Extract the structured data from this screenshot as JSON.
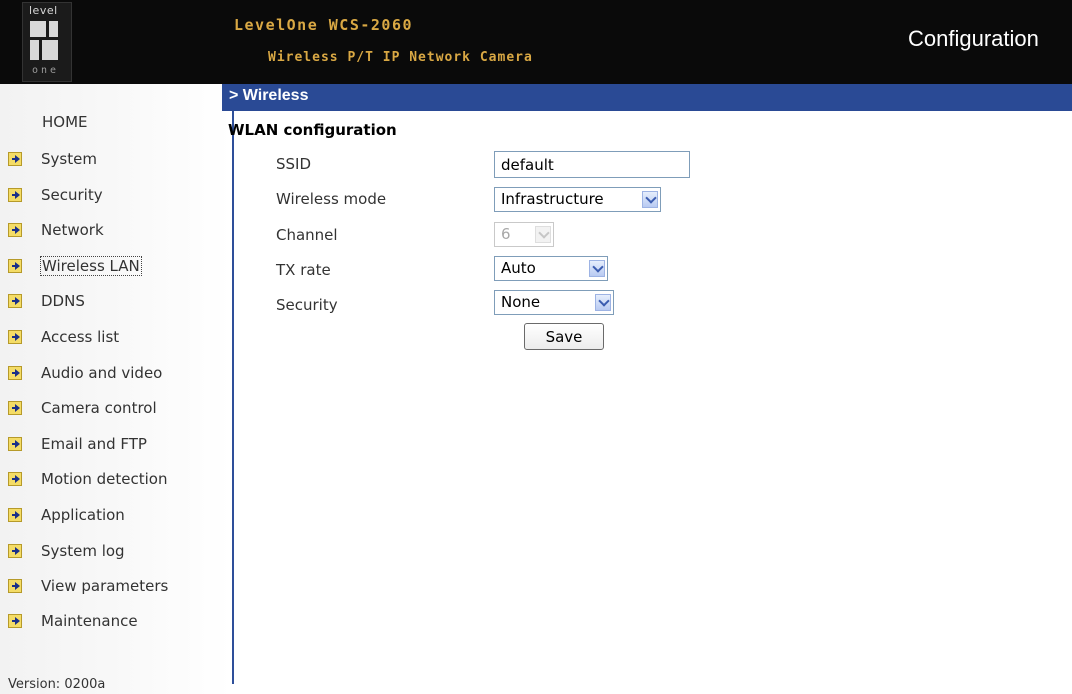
{
  "header": {
    "logo_text_top": "level",
    "logo_text_bottom": "one",
    "brand_line1": "LevelOne WCS-2060",
    "brand_line2": "Wireless P/T IP Network Camera",
    "page_title": "Configuration"
  },
  "sidebar": {
    "home": "HOME",
    "items": [
      {
        "label": "System"
      },
      {
        "label": "Security"
      },
      {
        "label": "Network"
      },
      {
        "label": "Wireless LAN"
      },
      {
        "label": "DDNS"
      },
      {
        "label": "Access list"
      },
      {
        "label": "Audio and video"
      },
      {
        "label": "Camera control"
      },
      {
        "label": "Email and FTP"
      },
      {
        "label": "Motion detection"
      },
      {
        "label": "Application"
      },
      {
        "label": "System log"
      },
      {
        "label": "View parameters"
      },
      {
        "label": "Maintenance"
      }
    ],
    "version": "Version: 0200a"
  },
  "main": {
    "breadcrumb": "> Wireless",
    "section_title": "WLAN configuration",
    "fields": {
      "ssid": {
        "label": "SSID",
        "value": "default"
      },
      "wireless_mode": {
        "label": "Wireless mode",
        "value": "Infrastructure"
      },
      "channel": {
        "label": "Channel",
        "value": "6"
      },
      "tx_rate": {
        "label": "TX rate",
        "value": "Auto"
      },
      "security": {
        "label": "Security",
        "value": "None"
      }
    },
    "save_label": "Save"
  },
  "colors": {
    "header_bg": "#0a0a0a",
    "brand_text": "#d9a844",
    "titlebar_bg": "#2a4a95",
    "sidebar_divider": "#2e4f9a"
  },
  "icons": {
    "nav_item_icon": "arrow-right-icon",
    "select_icon": "chevron-down-icon"
  }
}
